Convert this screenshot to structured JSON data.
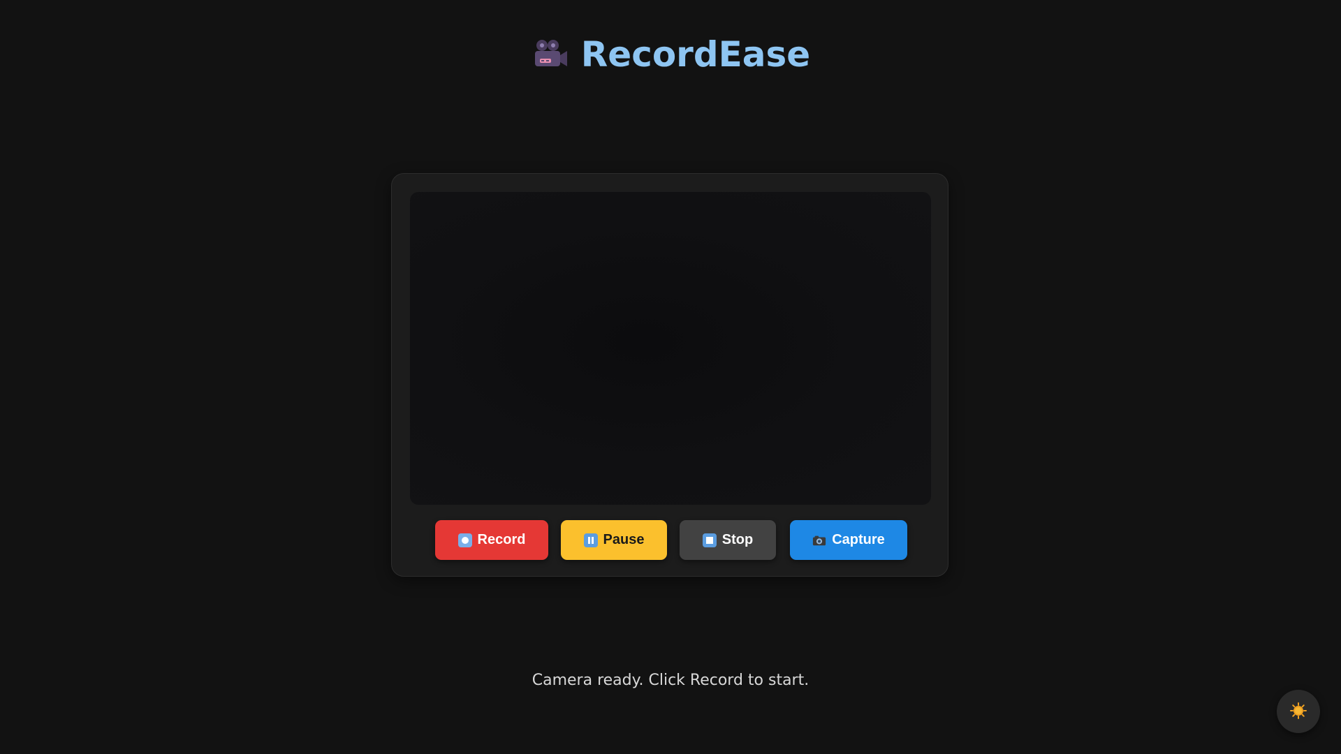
{
  "header": {
    "title": "RecordEase",
    "logo_icon": "movie-camera-icon"
  },
  "controls": {
    "record_label": "Record",
    "pause_label": "Pause",
    "stop_label": "Stop",
    "capture_label": "Capture",
    "record_icon": "record-icon",
    "pause_icon": "pause-icon",
    "stop_icon": "stop-icon",
    "capture_icon": "camera-icon"
  },
  "status": {
    "message": "Camera ready. Click Record to start."
  },
  "theme_toggle": {
    "icon": "sun-icon"
  },
  "colors": {
    "background": "#121212",
    "title": "#8ec5f2",
    "record": "#e53835",
    "pause": "#fbc02d",
    "stop": "#424242",
    "capture": "#1e88e5"
  }
}
